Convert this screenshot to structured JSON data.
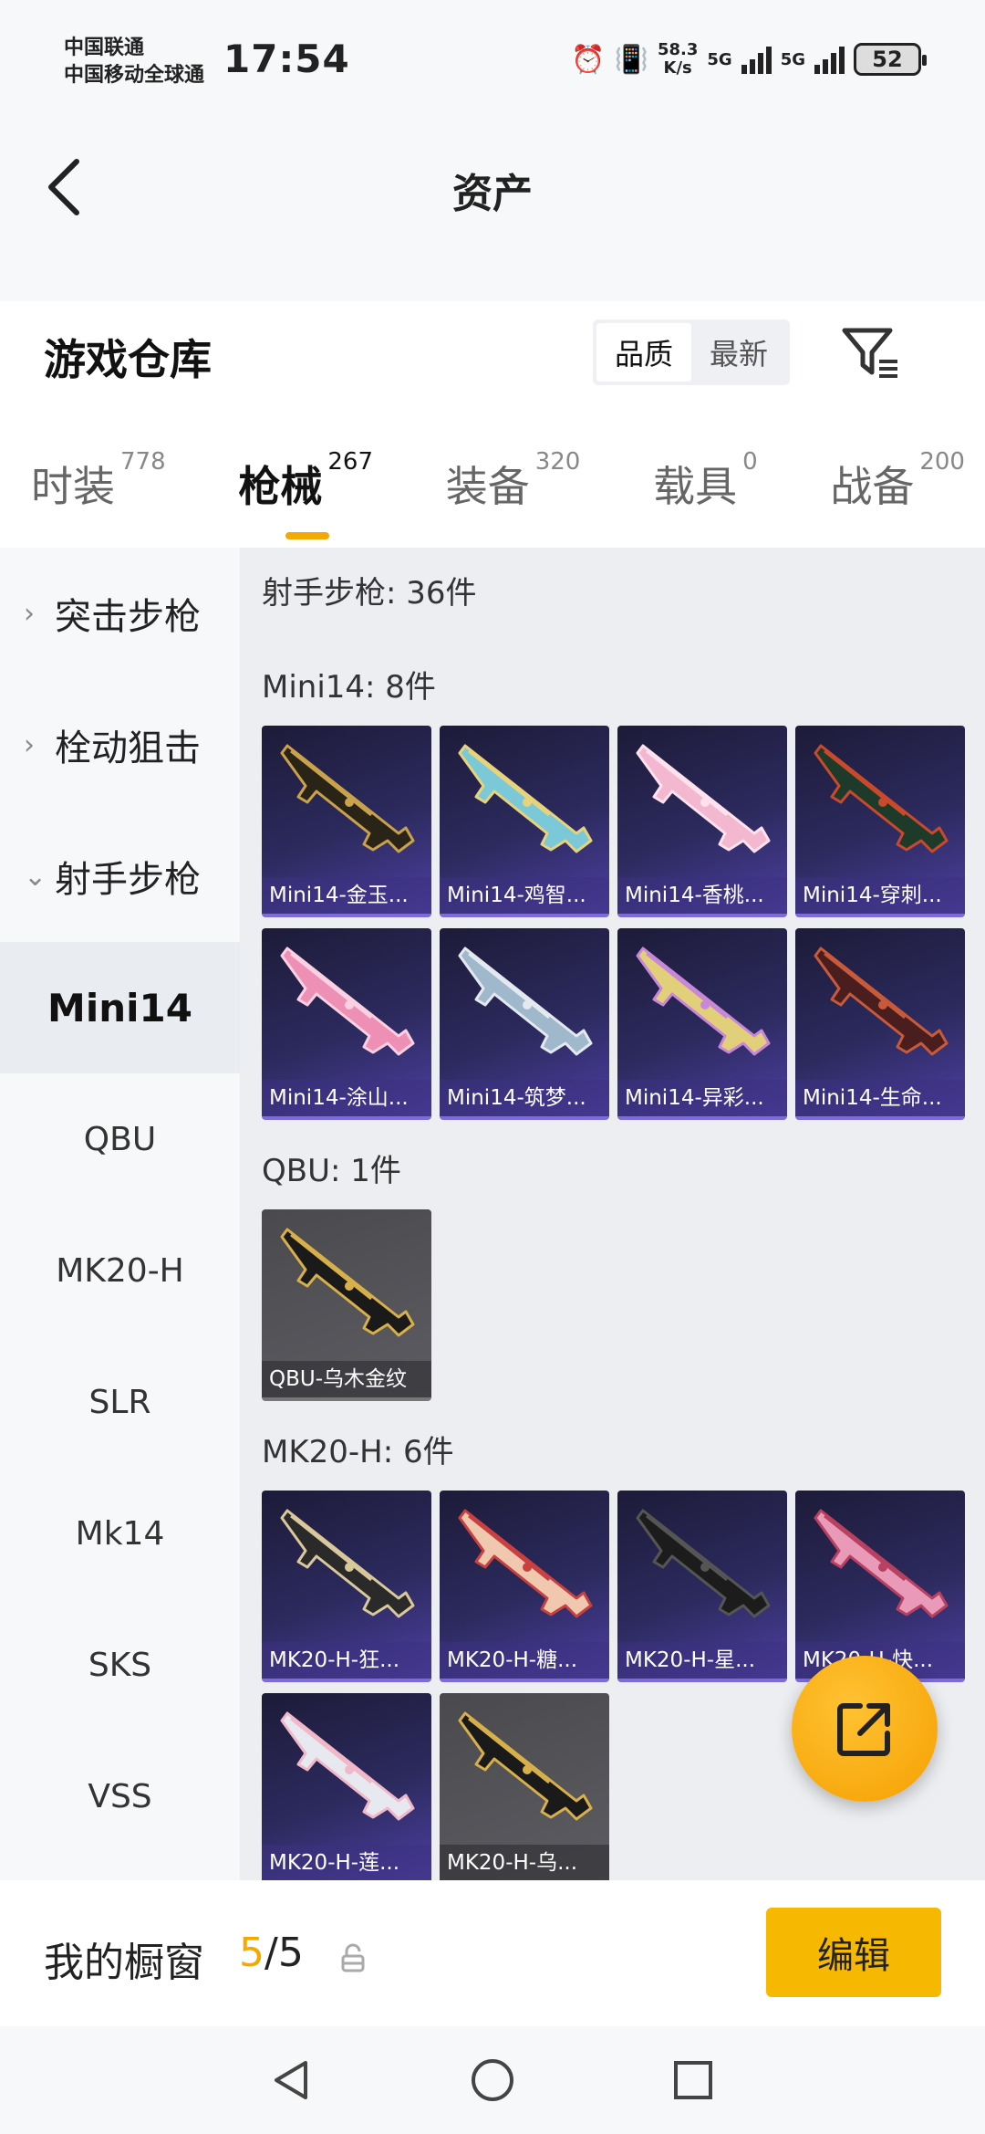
{
  "status_bar": {
    "carrier_1": "中国联通",
    "carrier_2": "中国移动全球通",
    "time": "17:54",
    "speed_value": "58.3",
    "speed_unit": "K/s",
    "net_1": "5G",
    "net_2": "5G",
    "battery": "52"
  },
  "header": {
    "title": "资产"
  },
  "warehouse": {
    "title": "游戏仓库",
    "sort_options": [
      "品质",
      "最新"
    ],
    "active_sort": "品质"
  },
  "tabs": [
    {
      "label": "时装",
      "count": "778"
    },
    {
      "label": "枪械",
      "count": "267",
      "active": true
    },
    {
      "label": "装备",
      "count": "320"
    },
    {
      "label": "载具",
      "count": "0"
    },
    {
      "label": "战备",
      "count": "200"
    }
  ],
  "sidebar": {
    "groups": [
      {
        "label": "突击步枪",
        "expanded": false
      },
      {
        "label": "栓动狙击",
        "expanded": false
      },
      {
        "label": "射手步枪",
        "expanded": true
      }
    ],
    "subitems": [
      "Mini14",
      "QBU",
      "MK20-H",
      "SLR",
      "Mk14",
      "SKS",
      "VSS"
    ],
    "active_subitem": "Mini14"
  },
  "content": {
    "category_header": "射手步枪: 36件",
    "sections": [
      {
        "header": "Mini14: 8件",
        "items": [
          {
            "name": "Mini14-金玉...",
            "bg": "purple",
            "colors": [
              "#2a2418",
              "#c9a24a"
            ]
          },
          {
            "name": "Mini14-鸡智...",
            "bg": "purple",
            "colors": [
              "#7ac8d8",
              "#e8d27a"
            ]
          },
          {
            "name": "Mini14-香桃...",
            "bg": "purple",
            "colors": [
              "#f3b8cf",
              "#ffe2ee"
            ]
          },
          {
            "name": "Mini14-穿刺...",
            "bg": "purple",
            "colors": [
              "#1e3a2a",
              "#c84a2a"
            ]
          },
          {
            "name": "Mini14-涂山...",
            "bg": "purple",
            "colors": [
              "#ee8fb6",
              "#fbd0e2"
            ]
          },
          {
            "name": "Mini14-筑梦...",
            "bg": "purple",
            "colors": [
              "#9fb8cc",
              "#e3e9ef"
            ]
          },
          {
            "name": "Mini14-异彩...",
            "bg": "purple",
            "colors": [
              "#e2cf7a",
              "#c888d8"
            ]
          },
          {
            "name": "Mini14-生命...",
            "bg": "purple",
            "colors": [
              "#4a1e1e",
              "#c85a3a"
            ]
          }
        ]
      },
      {
        "header": "QBU: 1件",
        "items": [
          {
            "name": "QBU-乌木金纹",
            "bg": "grey",
            "colors": [
              "#1a1a1a",
              "#d8b04a"
            ]
          }
        ]
      },
      {
        "header": "MK20-H: 6件",
        "items": [
          {
            "name": "MK20-H-狂...",
            "bg": "purple",
            "colors": [
              "#2a2a2a",
              "#d8c89a"
            ]
          },
          {
            "name": "MK20-H-糖...",
            "bg": "purple",
            "colors": [
              "#f0c8b0",
              "#c84040"
            ]
          },
          {
            "name": "MK20-H-星...",
            "bg": "purple",
            "colors": [
              "#1c1c1c",
              "#555555"
            ]
          },
          {
            "name": "MK20-H-快...",
            "bg": "purple",
            "colors": [
              "#e89ab8",
              "#b84060"
            ]
          },
          {
            "name": "MK20-H-莲...",
            "bg": "purple",
            "colors": [
              "#e8e8f0",
              "#f0b8c8"
            ]
          },
          {
            "name": "MK20-H-乌...",
            "bg": "grey",
            "colors": [
              "#1a1a1a",
              "#d8b04a"
            ]
          }
        ]
      }
    ]
  },
  "showcase": {
    "label": "我的橱窗",
    "current": "5",
    "separator": "/",
    "total": "5",
    "edit_label": "编辑"
  },
  "colors": {
    "accent": "#f5a800",
    "card_purple": "#2c2a5e",
    "card_grey": "#5c5c62"
  }
}
